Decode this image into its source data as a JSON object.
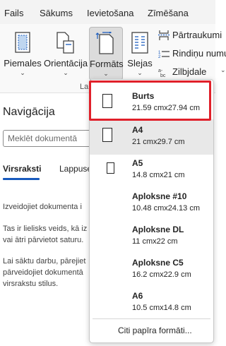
{
  "tabs": [
    "Fails",
    "Sākums",
    "Ievietošana",
    "Zīmēšana"
  ],
  "ribbon": {
    "margins_label": "Piemales",
    "orientation_label": "Orientācija",
    "formats_label": "Formāts",
    "columns_label": "Slejas",
    "breaks_label": "Pārtraukumi",
    "line_numbers_label": "Rindiņu numuri",
    "hyphenation_label": "Zilbjdale",
    "group_label": "La"
  },
  "navigation": {
    "title": "Navigācija",
    "search_placeholder": "Meklēt dokumentā",
    "tab_headings": "Virsraksti",
    "tab_pages": "Lappuses",
    "text_lines": [
      "Izveidojiet dokumenta i",
      "Tas ir lielisks veids, kā iz",
      "vai ātri pārvietot saturu.",
      "Lai sāktu darbu, pārejiet",
      "pārveidojiet dokumentā",
      "virsrakstu stilus."
    ]
  },
  "paper_sizes": [
    {
      "name": "Burts",
      "size": "21.59 cmx27.94 cm"
    },
    {
      "name": "A4",
      "size": "21 cmx29.7 cm"
    },
    {
      "name": "A5",
      "size": "14.8 cmx21 cm"
    },
    {
      "name": "Aploksne #10",
      "size": "10.48 cmx24.13 cm"
    },
    {
      "name": "Aploksne DL",
      "size": "11 cmx22 cm"
    },
    {
      "name": "Aploksne C5",
      "size": "16.2 cmx22.9 cm"
    },
    {
      "name": "A6",
      "size": "10.5 cmx14.8 cm"
    }
  ],
  "more_paper_sizes": "Citi papīra formāti...",
  "colors": {
    "accent": "#185abd",
    "highlight": "#e0202a"
  }
}
